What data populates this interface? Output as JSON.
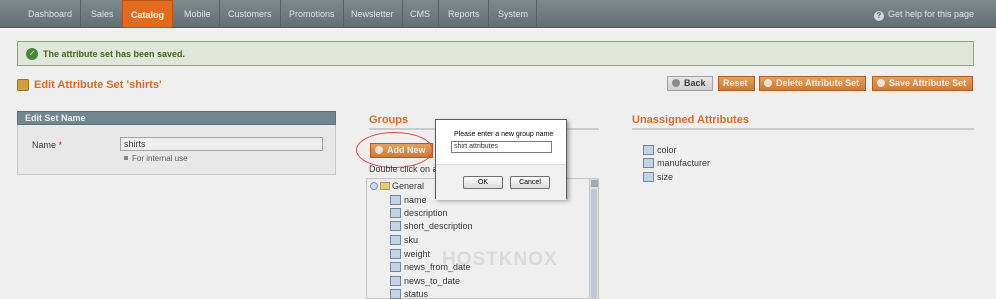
{
  "nav": {
    "items": [
      "Dashboard",
      "Sales",
      "Catalog",
      "Mobile",
      "Customers",
      "Promotions",
      "Newsletter",
      "CMS",
      "Reports",
      "System"
    ],
    "active": "Catalog",
    "help": "Get help for this page"
  },
  "message": {
    "text": "The attribute set has been saved."
  },
  "header": {
    "title": "Edit Attribute Set 'shirts'",
    "buttons": {
      "back": "Back",
      "reset": "Reset",
      "delete": "Delete Attribute Set",
      "save": "Save Attribute Set"
    }
  },
  "edit_set": {
    "heading": "Edit Set Name",
    "name_label": "Name",
    "required_mark": "*",
    "name_value": "shirts",
    "note": "For internal use"
  },
  "groups": {
    "title": "Groups",
    "add_new": "Add New",
    "hint": "Double click on a",
    "root": "General",
    "attributes": [
      "name",
      "description",
      "short_description",
      "sku",
      "weight",
      "news_from_date",
      "news_to_date",
      "status"
    ]
  },
  "unassigned": {
    "title": "Unassigned Attributes",
    "attributes": [
      "color",
      "manufacturer",
      "size"
    ]
  },
  "watermark": "HOSTKNOX",
  "dialog": {
    "prompt": "Please enter a new group name",
    "value": "shirt attributes",
    "ok": "OK",
    "cancel": "Cancel"
  },
  "colors": {
    "accent": "#e26b1e",
    "nav_bg": "#6b787c",
    "success": "#3d6611"
  }
}
